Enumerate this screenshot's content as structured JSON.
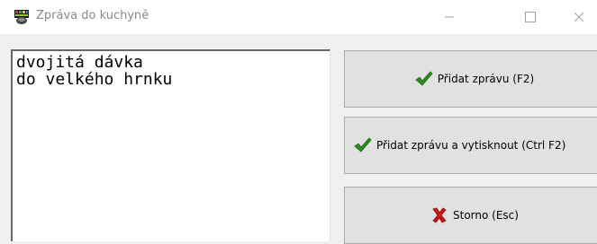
{
  "window": {
    "title": "Zpráva do kuchyně",
    "icon": "kitchen-app-icon",
    "controls": [
      "minimize-icon",
      "maximize-icon",
      "close-icon"
    ]
  },
  "message": {
    "text": "dvojitá dávka\ndo velkého hrnku"
  },
  "buttons": {
    "add": {
      "label": "Přidat zprávu (F2)",
      "icon": "checkmark-icon"
    },
    "add_print": {
      "label": "Přidat zprávu a vytisknout (Ctrl F2)",
      "icon": "checkmark-icon"
    },
    "cancel": {
      "label": "Storno (Esc)",
      "icon": "red-x-icon"
    }
  },
  "colors": {
    "check_green": "#2e8b1e",
    "cancel_red": "#c8170f"
  }
}
